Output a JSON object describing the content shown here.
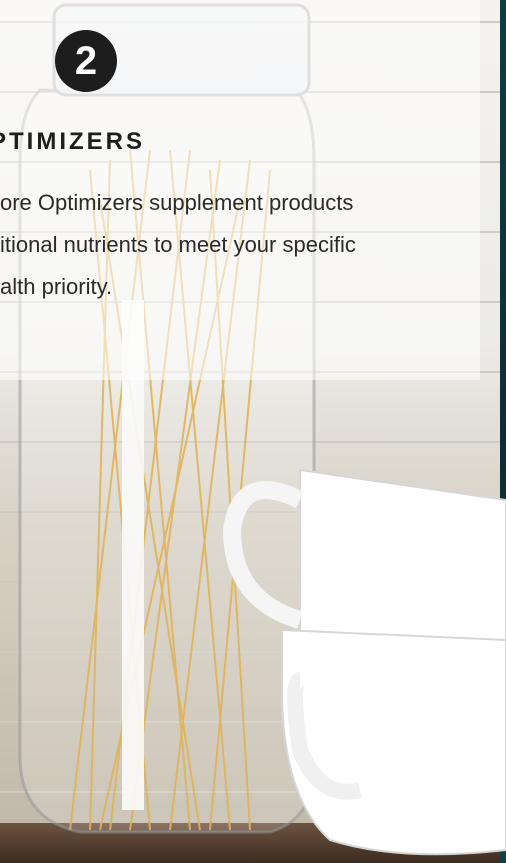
{
  "step": {
    "number": "2"
  },
  "section": {
    "heading": "PTIMIZERS",
    "lines": [
      "ore Optimizers supplement products",
      "itional nutrients to meet your specific",
      "alth priority."
    ]
  },
  "colors": {
    "badge": "#1d1d1d",
    "text": "#2a2a2a",
    "panel_overlay": "rgba(255,255,255,0.55)",
    "pasta": "#e0b35a",
    "accent_edge": "#0e3d44"
  },
  "illustration": {
    "subject": "glass jar of spaghetti with stacked white cups",
    "icons": [
      "jar-icon",
      "cup-icon"
    ]
  }
}
